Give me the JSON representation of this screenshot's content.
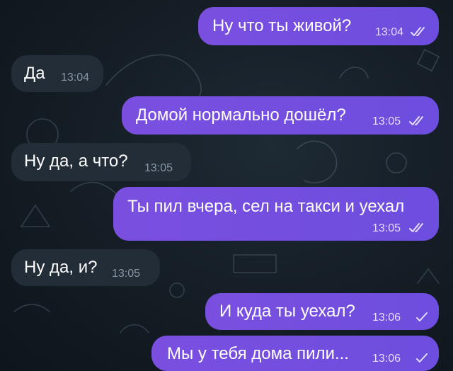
{
  "messages": [
    {
      "id": "m1",
      "direction": "outgoing",
      "text": "Ну что ты живой?",
      "time": "13:04",
      "status": "read"
    },
    {
      "id": "m2",
      "direction": "incoming",
      "text": "Да",
      "time": "13:04"
    },
    {
      "id": "m3",
      "direction": "outgoing",
      "text": "Домой нормально дошёл?",
      "time": "13:05",
      "status": "read"
    },
    {
      "id": "m4",
      "direction": "incoming",
      "text": "Ну да, а что?",
      "time": "13:05"
    },
    {
      "id": "m5",
      "direction": "outgoing",
      "text": "Ты пил вчера, сел на такси и уехал",
      "time": "13:05",
      "status": "read"
    },
    {
      "id": "m6",
      "direction": "incoming",
      "text": "Ну да, и?",
      "time": "13:05"
    },
    {
      "id": "m7",
      "direction": "outgoing",
      "text": "И куда ты уехал?",
      "time": "13:06",
      "status": "sent"
    },
    {
      "id": "m8",
      "direction": "outgoing",
      "text": "Мы у тебя дома пили...",
      "time": "13:06",
      "status": "sent"
    }
  ],
  "icons": {
    "read": "double-check-icon",
    "sent": "single-check-icon"
  },
  "colors": {
    "outgoing_bubble": "#7a4fe0",
    "incoming_bubble": "#222d38",
    "background": "#141c24"
  }
}
